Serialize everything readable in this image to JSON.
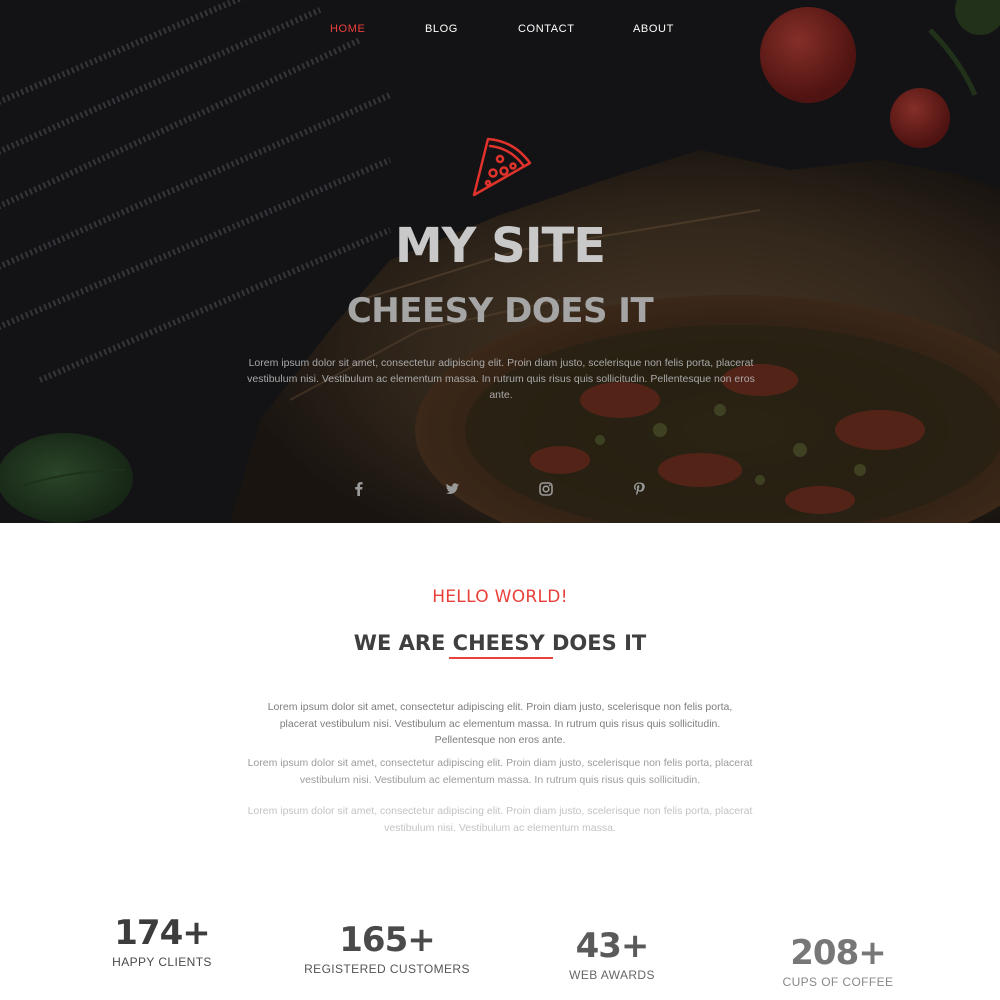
{
  "nav": {
    "items": [
      {
        "label": "HOME",
        "active": true
      },
      {
        "label": "BLOG",
        "active": false
      },
      {
        "label": "CONTACT",
        "active": false
      },
      {
        "label": "ABOUT",
        "active": false
      }
    ]
  },
  "hero": {
    "logo_icon": "pizza-slice-icon",
    "title": "MY SITE",
    "subtitle": "CHEESY DOES IT",
    "text": "Lorem ipsum dolor sit amet, consectetur adipiscing elit. Proin diam justo, scelerisque non felis porta, placerat vestibulum nisi. Vestibulum ac elementum massa. In rutrum quis risus quis sollicitudin. Pellentesque non eros ante.",
    "social_icons": [
      "facebook-icon",
      "twitter-icon",
      "instagram-icon",
      "pinterest-icon"
    ]
  },
  "about": {
    "kicker": "HELLO WORLD!",
    "heading": "WE ARE CHEESY DOES IT",
    "paragraphs": [
      "Lorem ipsum dolor sit amet, consectetur adipiscing elit. Proin diam justo, scelerisque non felis porta, placerat vestibulum nisi. Vestibulum ac elementum massa. In rutrum quis risus quis sollicitudin. Pellentesque non eros ante.",
      "Lorem ipsum dolor sit amet, consectetur adipiscing elit. Proin diam justo, scelerisque non felis porta, placerat vestibulum nisi. Vestibulum ac elementum massa. In rutrum quis risus quis sollicitudin.",
      "Lorem ipsum dolor sit amet, consectetur adipiscing elit. Proin diam justo, scelerisque non felis porta, placerat vestibulum nisi. Vestibulum ac elementum massa."
    ]
  },
  "stats": [
    {
      "value": "174+",
      "label": "HAPPY CLIENTS"
    },
    {
      "value": "165+",
      "label": "REGISTERED CUSTOMERS"
    },
    {
      "value": "43+",
      "label": "WEB AWARDS"
    },
    {
      "value": "208+",
      "label": "CUPS OF COFFEE"
    }
  ],
  "colors": {
    "accent": "#e8403a",
    "heading": "#3f3f3f",
    "hero_bg": "#151516"
  }
}
